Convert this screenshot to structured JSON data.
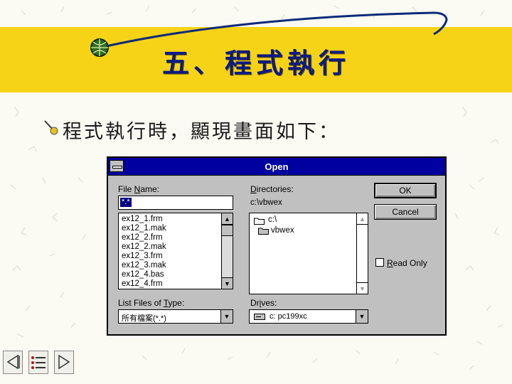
{
  "slide": {
    "title": "五、程式執行",
    "bullet": "程式執行時，顯現畫面如下："
  },
  "dialog": {
    "title": "Open",
    "file_name_label": "File Name:",
    "file_name_value": "*.*",
    "directories_label": "Directories:",
    "current_dir": "c:\\vbwex",
    "files": [
      "ex12_1.frm",
      "ex12_1.mak",
      "ex12_2.frm",
      "ex12_2.mak",
      "ex12_3.frm",
      "ex12_3.mak",
      "ex12_4.bas",
      "ex12_4.frm"
    ],
    "dir_tree": [
      "c:\\",
      "vbwex"
    ],
    "ok_label": "OK",
    "cancel_label": "Cancel",
    "read_only_label": "Read Only",
    "list_types_label": "List Files of Type:",
    "list_types_value": "所有檔案(*.*)",
    "drives_label": "Drives:",
    "drive_value": "c: pc199xc"
  },
  "colors": {
    "banner": "#f7d317",
    "title": "#0c1a84",
    "titlebar": "#0000a0",
    "dialog_face": "#c0c0c0"
  },
  "icons": [
    "globe-icon",
    "bullet-icon",
    "sysmenu-icon",
    "scroll-up-icon",
    "scroll-down-icon",
    "folder-open-icon",
    "dropdown-arrow-icon",
    "drive-icon",
    "nav-home-icon",
    "nav-outline-icon",
    "nav-next-icon"
  ]
}
